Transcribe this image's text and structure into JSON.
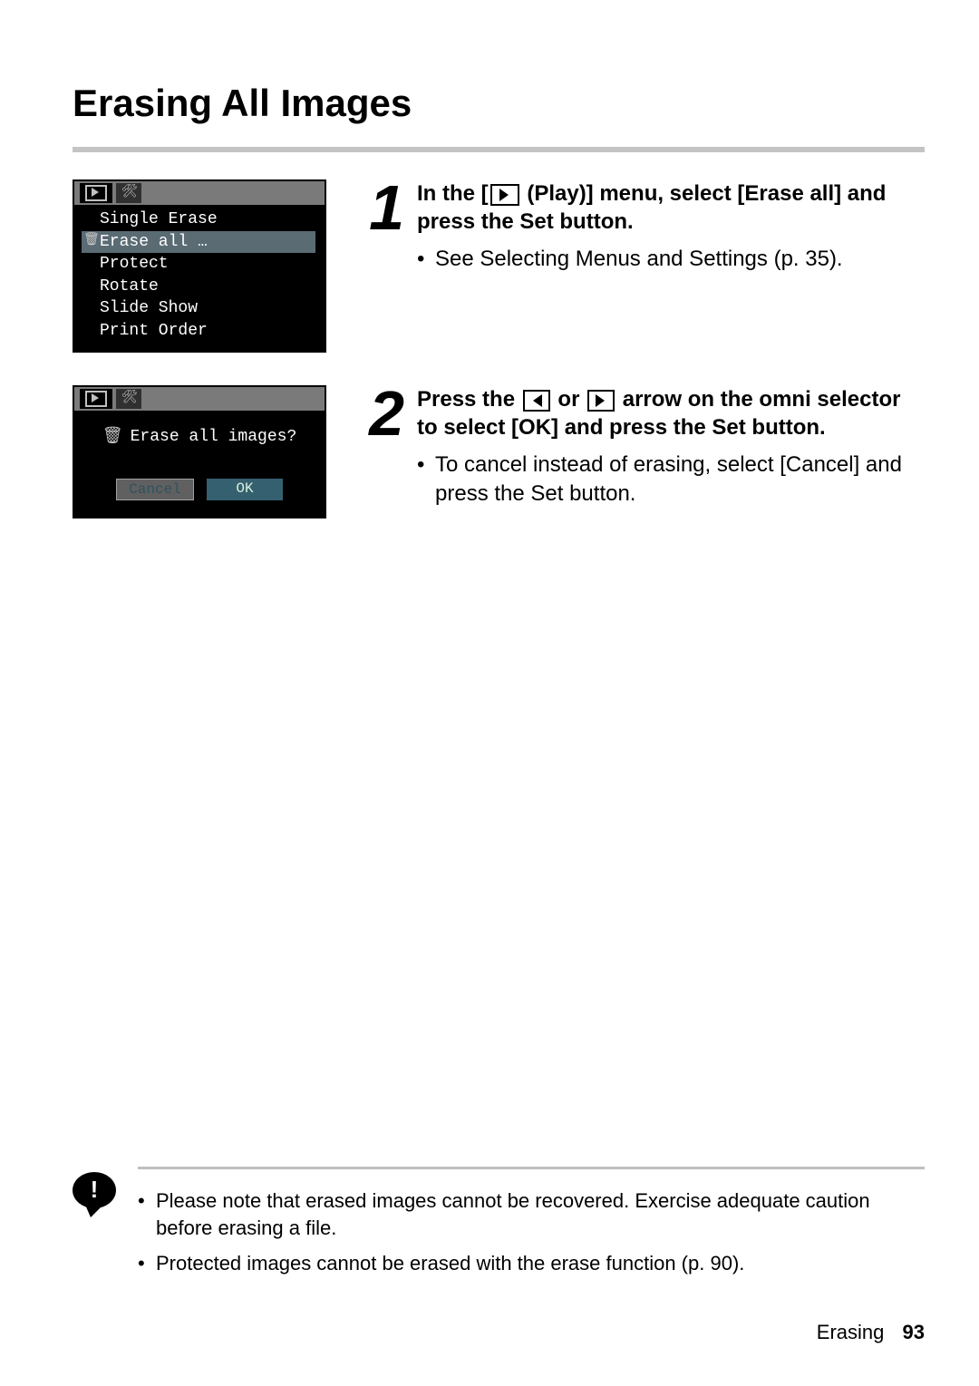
{
  "title": "Erasing All Images",
  "steps": [
    {
      "num": "1",
      "head_parts": {
        "a": "In the [",
        "b": " (Play)] menu, select [Erase all] and press the Set button."
      },
      "bullets": [
        "See Selecting Menus and Settings (p. 35)."
      ],
      "shot": {
        "menu": [
          {
            "label": "Single Erase",
            "selected": false
          },
          {
            "label": "Erase all …",
            "selected": true
          },
          {
            "label": "Protect",
            "selected": false
          },
          {
            "label": "Rotate",
            "selected": false
          },
          {
            "label": "Slide Show",
            "selected": false
          },
          {
            "label": "Print Order",
            "selected": false
          }
        ]
      }
    },
    {
      "num": "2",
      "head_parts": {
        "a": "Press the ",
        "b": " or ",
        "c": " arrow on the omni selector to select [OK] and press the Set button."
      },
      "bullets": [
        "To cancel instead of erasing, select [Cancel] and press the Set button."
      ],
      "shot_confirm": {
        "question": "Erase all images?",
        "cancel": "Cancel",
        "ok": "OK"
      }
    }
  ],
  "notes": [
    "Please note that erased images cannot be recovered. Exercise adequate caution before erasing a file.",
    "Protected images cannot be erased with the erase function (p. 90)."
  ],
  "footer": {
    "section": "Erasing",
    "page": "93"
  }
}
